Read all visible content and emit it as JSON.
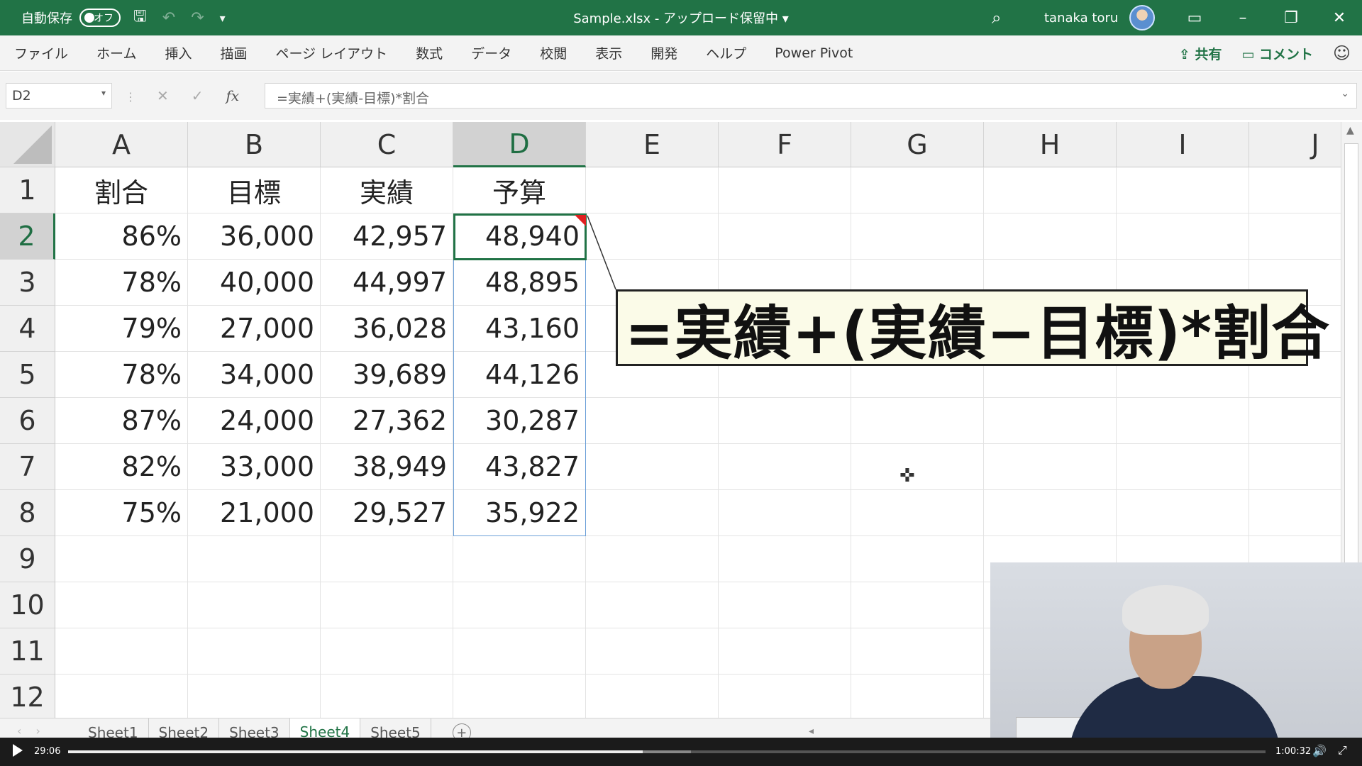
{
  "titlebar": {
    "autosave_label": "自動保存",
    "autosave_state": "オフ",
    "document_title": "Sample.xlsx - アップロード保留中 ▾",
    "user_name": "tanaka toru",
    "accent_color": "#217346"
  },
  "ribbon": {
    "tabs": [
      "ファイル",
      "ホーム",
      "挿入",
      "描画",
      "ページ レイアウト",
      "数式",
      "データ",
      "校閲",
      "表示",
      "開発",
      "ヘルプ",
      "Power Pivot"
    ],
    "share_label": "⇪ 共有",
    "comment_label": "▭ コメント"
  },
  "formula_bar": {
    "name_box": "D2",
    "formula": "=実績+(実績-目標)*割合"
  },
  "columns": [
    "A",
    "B",
    "C",
    "D",
    "E",
    "F",
    "G",
    "H",
    "I",
    "J"
  ],
  "rows": [
    "1",
    "2",
    "3",
    "4",
    "5",
    "6",
    "7",
    "8",
    "9",
    "10",
    "11",
    "12"
  ],
  "table": {
    "headers": [
      "割合",
      "目標",
      "実績",
      "予算"
    ],
    "rows": [
      [
        "86%",
        "36,000",
        "42,957",
        "48,940"
      ],
      [
        "78%",
        "40,000",
        "44,997",
        "48,895"
      ],
      [
        "79%",
        "27,000",
        "36,028",
        "43,160"
      ],
      [
        "78%",
        "34,000",
        "39,689",
        "44,126"
      ],
      [
        "87%",
        "24,000",
        "27,362",
        "30,287"
      ],
      [
        "82%",
        "33,000",
        "38,949",
        "43,827"
      ],
      [
        "75%",
        "21,000",
        "29,527",
        "35,922"
      ]
    ]
  },
  "callout": {
    "text": "=実績+(実績−目標)*割合"
  },
  "sheets": {
    "tabs": [
      "Sheet1",
      "Sheet2",
      "Sheet3",
      "Sheet4",
      "Sheet5"
    ],
    "active": "Sheet4"
  },
  "player": {
    "current_time": "29:06",
    "total_time": "1:00:32",
    "progress": 0.48,
    "buffered": 0.52
  }
}
